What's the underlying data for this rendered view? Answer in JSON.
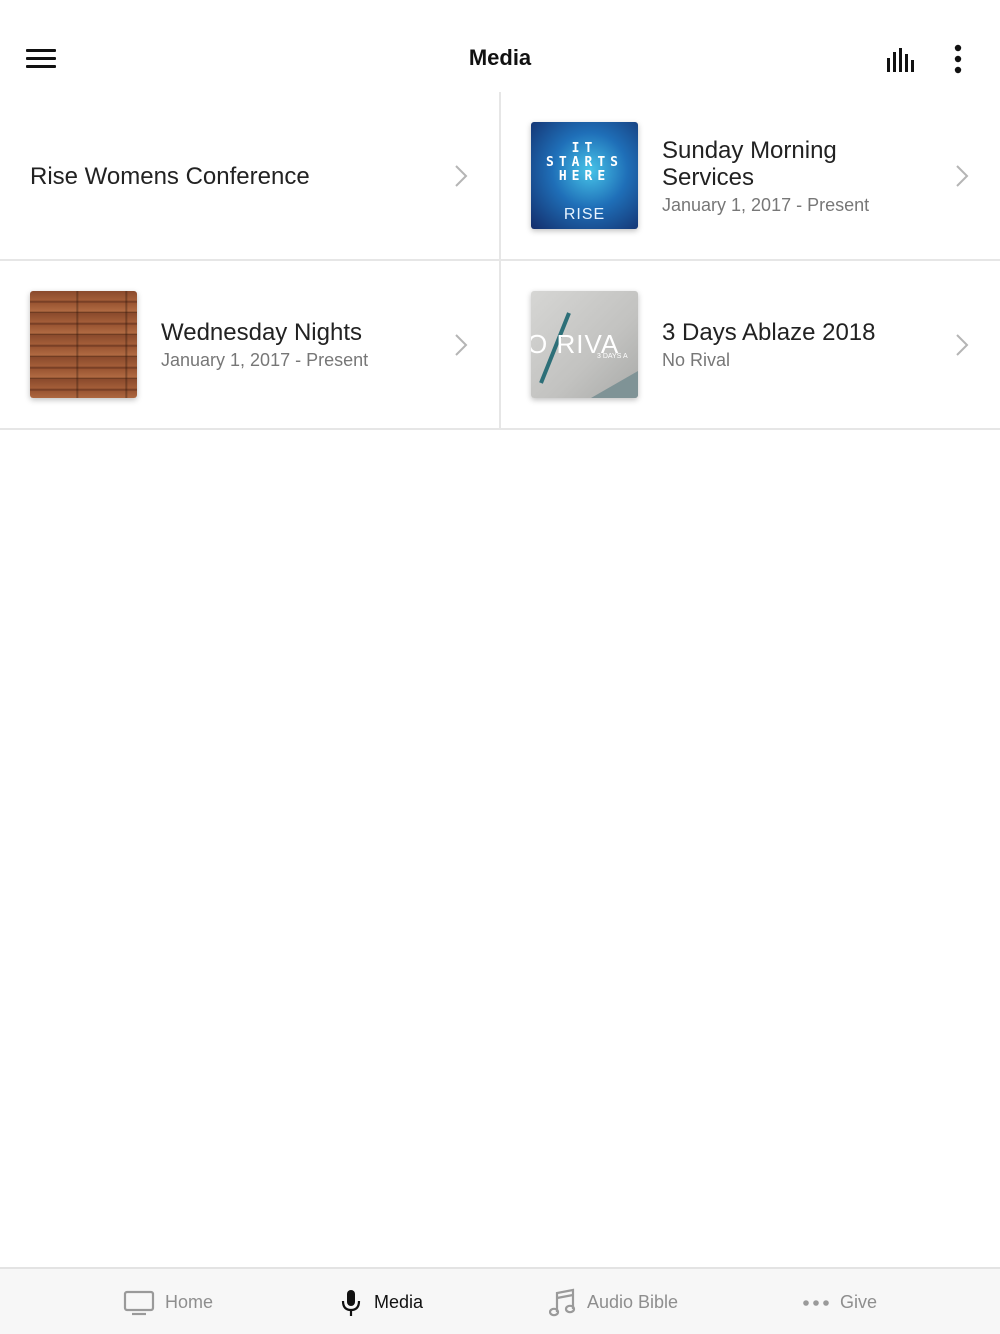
{
  "header": {
    "title": "Media",
    "menu_icon": "hamburger-menu-icon",
    "eq_icon": "audio-bars-icon",
    "more_icon": "vertical-dots-icon"
  },
  "media_items": [
    {
      "title": "Rise Womens Conference",
      "subtitle": ""
    },
    {
      "title": "Sunday Morning Services",
      "subtitle": "January 1, 2017 - Present",
      "art_lines": [
        "IT",
        "STARTS",
        "HERE"
      ],
      "art_brand": "RISE"
    },
    {
      "title": "Wednesday Nights",
      "subtitle": "January 1, 2017 - Present"
    },
    {
      "title": "3 Days Ablaze 2018",
      "subtitle": "No Rival",
      "art_text": "O RIVA",
      "art_small": "3 DAYS A"
    }
  ],
  "tabs": [
    {
      "label": "Home",
      "icon": "tv-icon",
      "active": false
    },
    {
      "label": "Media",
      "icon": "microphone-icon",
      "active": true
    },
    {
      "label": "Audio Bible",
      "icon": "music-note-icon",
      "active": false
    },
    {
      "label": "Give",
      "icon": "ellipsis-icon",
      "active": false
    }
  ],
  "colors": {
    "accent": "#111111",
    "divider": "#e6e6e6",
    "muted": "#8e8e8e"
  }
}
